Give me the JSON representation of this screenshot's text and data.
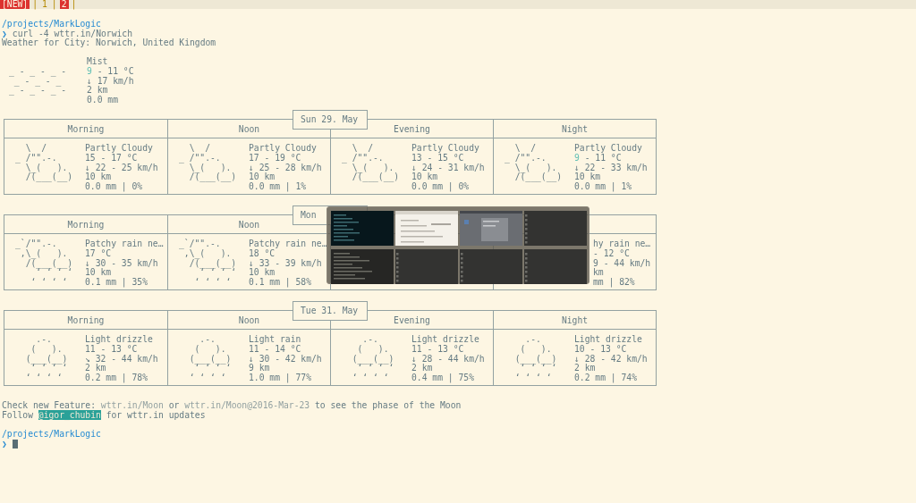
{
  "tabs": [
    {
      "label": "[NEW]",
      "alert": true,
      "separator": "|"
    },
    {
      "label": "1",
      "alert": false,
      "separator": "|"
    },
    {
      "label": "2",
      "alert": true,
      "separator": "|"
    }
  ],
  "prompt": {
    "path": "/projects/MarkLogic",
    "symbol": "❯",
    "command": "curl -4 wttr.in/Norwich"
  },
  "location_line": "Weather for City: Norwich, United Kingdom",
  "current": {
    "art": [
      "_ - _ - _ -",
      " _ - _ - _",
      "_ - _ - _ -"
    ],
    "condition": "Mist",
    "temp_low": "9",
    "temp": "- 11 °C",
    "wind": "↓ 17 km/h",
    "visibility": "2 km",
    "precip": "0.0 mm"
  },
  "days": [
    {
      "date": "Sun 29. May",
      "periods": [
        {
          "kind": "full",
          "name": "Morning",
          "art": [
            "  \\  /",
            "_ /\"\".-.",
            "  \\_(   ).",
            "  /(___(__)"
          ],
          "condition": "Partly Cloudy",
          "temp": "15 - 17 °C",
          "wind": "↓ 22 - 25 km/h",
          "visibility": "10 km",
          "precip": "0.0 mm | 0%"
        },
        {
          "kind": "full",
          "name": "Noon",
          "art": [
            "  \\  /",
            "_ /\"\".-.",
            "  \\_(   ).",
            "  /(___(__)"
          ],
          "condition": "Partly Cloudy",
          "temp": "17 - 19 °C",
          "wind": "↓ 25 - 28 km/h",
          "visibility": "10 km",
          "precip": "0.0 mm | 1%"
        },
        {
          "kind": "full",
          "name": "Evening",
          "art": [
            "  \\  /",
            "_ /\"\".-.",
            "  \\_(   ).",
            "  /(___(__)"
          ],
          "condition": "Partly Cloudy",
          "temp": "13 - 15 °C",
          "wind": "↓ 24 - 31 km/h",
          "visibility": "10 km",
          "precip": "0.0 mm | 0%"
        },
        {
          "kind": "full",
          "name": "Night",
          "art": [
            "  \\  /",
            "_ /\"\".-.",
            "  \\_(   ).",
            "  /(___(__)"
          ],
          "condition": "Partly Cloudy",
          "temp_low": "9",
          "temp": "- 11 °C",
          "wind": "↓ 22 - 33 km/h",
          "visibility": "10 km",
          "precip": "0.0 mm | 1%"
        }
      ]
    },
    {
      "date": "Mon",
      "periods": [
        {
          "kind": "full",
          "name": "Morning",
          "art": [
            "_`/\"\".-.",
            " ,\\_(   ).",
            "  /(___(__)",
            "    ‘ ‘ ‘ ‘",
            "   ‘ ‘ ‘ ‘"
          ],
          "condition": "Patchy rain ne…",
          "temp": "17 °C",
          "wind": "↓ 30 - 35 km/h",
          "visibility": "10 km",
          "precip": "0.1 mm | 35%"
        },
        {
          "kind": "full",
          "name": "Noon",
          "art": [
            "_`/\"\".-.",
            " ,\\_(   ).",
            "  /(___(__)",
            "    ‘ ‘ ‘ ‘",
            "   ‘ ‘ ‘ ‘"
          ],
          "condition": "Patchy rain ne…",
          "temp": "18 °C",
          "wind": "↓ 33 - 39 km/h",
          "visibility": "10 km",
          "precip": "0.1 mm | 58%"
        },
        {
          "kind": "covered"
        },
        {
          "kind": "partial",
          "condition": "hy rain ne…",
          "temp": "- 12 °C",
          "wind": "9 - 44 km/h",
          "visibility": "km",
          "precip": "mm | 82%"
        }
      ]
    },
    {
      "date": "Tue 31. May",
      "periods": [
        {
          "kind": "full",
          "name": "Morning",
          "art": [
            "    .-.",
            "   (   ).",
            "  (___(__)",
            "   ‘ ‘ ‘ ‘",
            "  ‘ ‘ ‘ ‘"
          ],
          "condition": "Light drizzle",
          "temp": "11 - 13 °C",
          "wind": "↘ 32 - 44 km/h",
          "visibility": "2 km",
          "precip": "0.2 mm | 78%"
        },
        {
          "kind": "full",
          "name": "Noon",
          "art": [
            "    .-.",
            "   (   ).",
            "  (___(__)",
            "   ‘ ‘ ‘ ‘",
            "  ‘ ‘ ‘ ‘"
          ],
          "condition": "Light rain",
          "temp": "11 - 14 °C",
          "wind": "↓ 30 - 42 km/h",
          "visibility": "9 km",
          "precip": "1.0 mm | 77%"
        },
        {
          "kind": "full",
          "name": "Evening",
          "art": [
            "    .-.",
            "   (   ).",
            "  (___(__)",
            "   ‘ ‘ ‘ ‘",
            "  ‘ ‘ ‘ ‘"
          ],
          "condition": "Light drizzle",
          "temp": "11 - 13 °C",
          "wind": "↓ 28 - 44 km/h",
          "visibility": "2 km",
          "precip": "0.4 mm | 75%"
        },
        {
          "kind": "full",
          "name": "Night",
          "art": [
            "    .-.",
            "   (   ).",
            "  (___(__)",
            "   ‘ ‘ ‘ ‘",
            "  ‘ ‘ ‘ ‘"
          ],
          "condition": "Light drizzle",
          "temp": "10 - 13 °C",
          "wind": "↓ 28 - 42 km/h",
          "visibility": "2 km",
          "precip": "0.2 mm | 74%"
        }
      ]
    }
  ],
  "feature_note": [
    {
      "kind": "text",
      "text": "Check new Feature:"
    },
    {
      "kind": "link",
      "text": "wttr.in/Moon"
    },
    {
      "kind": "text",
      "text": "or"
    },
    {
      "kind": "link",
      "text": "wttr.in/Moon@2016-Mar-23"
    },
    {
      "kind": "text",
      "text": "to see the phase of the Moon"
    }
  ],
  "follow_note": [
    {
      "kind": "text",
      "text": "Follow"
    },
    {
      "kind": "highlight",
      "text": "@igor_chubin"
    },
    {
      "kind": "text",
      "text": "for wttr.in updates"
    }
  ],
  "final_prompt": {
    "path": "/projects/MarkLogic",
    "symbol": "❯"
  },
  "window_switcher": {
    "thumbnails": [
      {
        "kind": "dark-terminal"
      },
      {
        "kind": "light-document"
      },
      {
        "kind": "grey-desktop"
      },
      {
        "kind": "empty"
      },
      {
        "kind": "grey-terminal"
      },
      {
        "kind": "empty"
      },
      {
        "kind": "empty"
      },
      {
        "kind": "empty"
      }
    ]
  }
}
